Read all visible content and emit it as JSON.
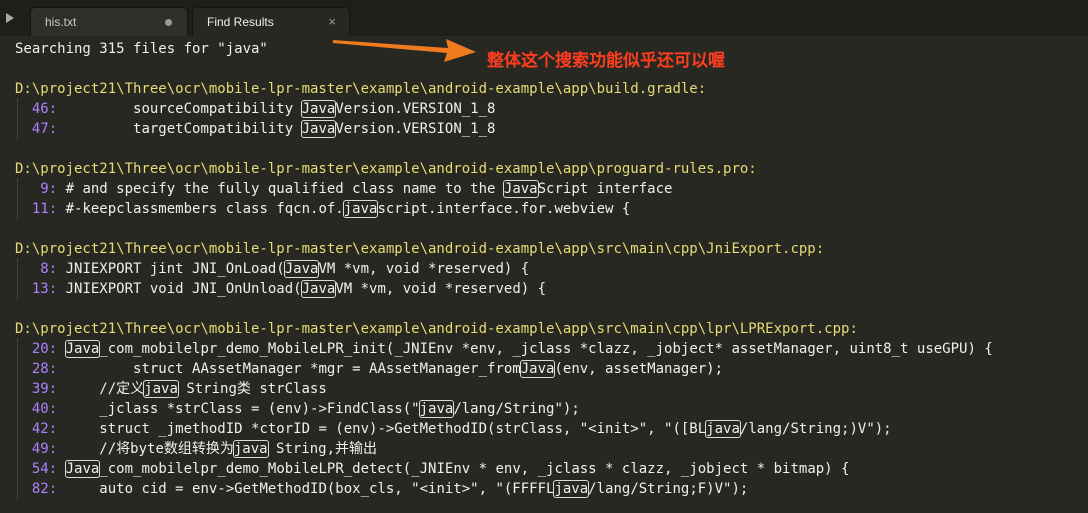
{
  "tabs": [
    {
      "label": "his.txt",
      "active": false,
      "modified": true
    },
    {
      "label": "Find Results",
      "active": true
    }
  ],
  "icons": {
    "tab_scroll": "play-triangle-icon",
    "tab_modified": "dot-icon",
    "tab_close": "close-icon"
  },
  "colors": {
    "path": "#e6db74",
    "line_number": "#ae81ff",
    "text": "#f0f0ea",
    "annotation": "#ff3d1f",
    "arrow": "#f07a1e"
  },
  "search_summary": "Searching 315 files for \"java\"",
  "annotation": "整体这个搜索功能似乎还可以喔",
  "results": [
    {
      "path": "D:\\project21\\Three\\ocr\\mobile-lpr-master\\example\\android-example\\app\\build.gradle:",
      "lines": [
        {
          "num": "46:",
          "segments": [
            "         sourceCompatibility ",
            "Java",
            "Version.VERSION_1_8"
          ]
        },
        {
          "num": "47:",
          "segments": [
            "         targetCompatibility ",
            "Java",
            "Version.VERSION_1_8"
          ]
        }
      ]
    },
    {
      "path": "D:\\project21\\Three\\ocr\\mobile-lpr-master\\example\\android-example\\app\\proguard-rules.pro:",
      "lines": [
        {
          "num": "9:",
          "segments": [
            " # and specify the fully qualified class name to the ",
            "Java",
            "Script interface"
          ]
        },
        {
          "num": "11:",
          "segments": [
            " #-keepclassmembers class fqcn.of.",
            "java",
            "script.interface.for.webview {"
          ]
        }
      ]
    },
    {
      "path": "D:\\project21\\Three\\ocr\\mobile-lpr-master\\example\\android-example\\app\\src\\main\\cpp\\JniExport.cpp:",
      "lines": [
        {
          "num": "8:",
          "segments": [
            " JNIEXPORT jint JNI_OnLoad(",
            "Java",
            "VM *vm, void *reserved) {"
          ]
        },
        {
          "num": "13:",
          "segments": [
            " JNIEXPORT void JNI_OnUnload(",
            "Java",
            "VM *vm, void *reserved) {"
          ]
        }
      ]
    },
    {
      "path": "D:\\project21\\Three\\ocr\\mobile-lpr-master\\example\\android-example\\app\\src\\main\\cpp\\lpr\\LPRExport.cpp:",
      "lines": [
        {
          "num": "20:",
          "segments": [
            " ",
            "Java",
            "_com_mobilelpr_demo_MobileLPR_init(_JNIEnv *env, _jclass *clazz, _jobject* assetManager, uint8_t useGPU) {"
          ]
        },
        {
          "num": "28:",
          "segments": [
            "         struct AAssetManager *mgr = AAssetManager_from",
            "Java",
            "(env, assetManager);"
          ]
        },
        {
          "num": "39:",
          "segments": [
            "     //定义",
            "java",
            " String类 strClass"
          ]
        },
        {
          "num": "40:",
          "segments": [
            "     _jclass *strClass = (env)->FindClass(\"",
            "java",
            "/lang/String\");"
          ]
        },
        {
          "num": "42:",
          "segments": [
            "     struct _jmethodID *ctorID = (env)->GetMethodID(strClass, \"<init>\", \"([BL",
            "java",
            "/lang/String;)V\");"
          ]
        },
        {
          "num": "49:",
          "segments": [
            "     //将byte数组转换为",
            "java",
            " String,并输出"
          ]
        },
        {
          "num": "54:",
          "segments": [
            " ",
            "Java",
            "_com_mobilelpr_demo_MobileLPR_detect(_JNIEnv * env, _jclass * clazz, _jobject * bitmap) {"
          ]
        },
        {
          "num": "82:",
          "segments": [
            "     auto cid = env->GetMethodID(box_cls, \"<init>\", \"(FFFFL",
            "java",
            "/lang/String;F)V\");"
          ]
        }
      ]
    }
  ]
}
